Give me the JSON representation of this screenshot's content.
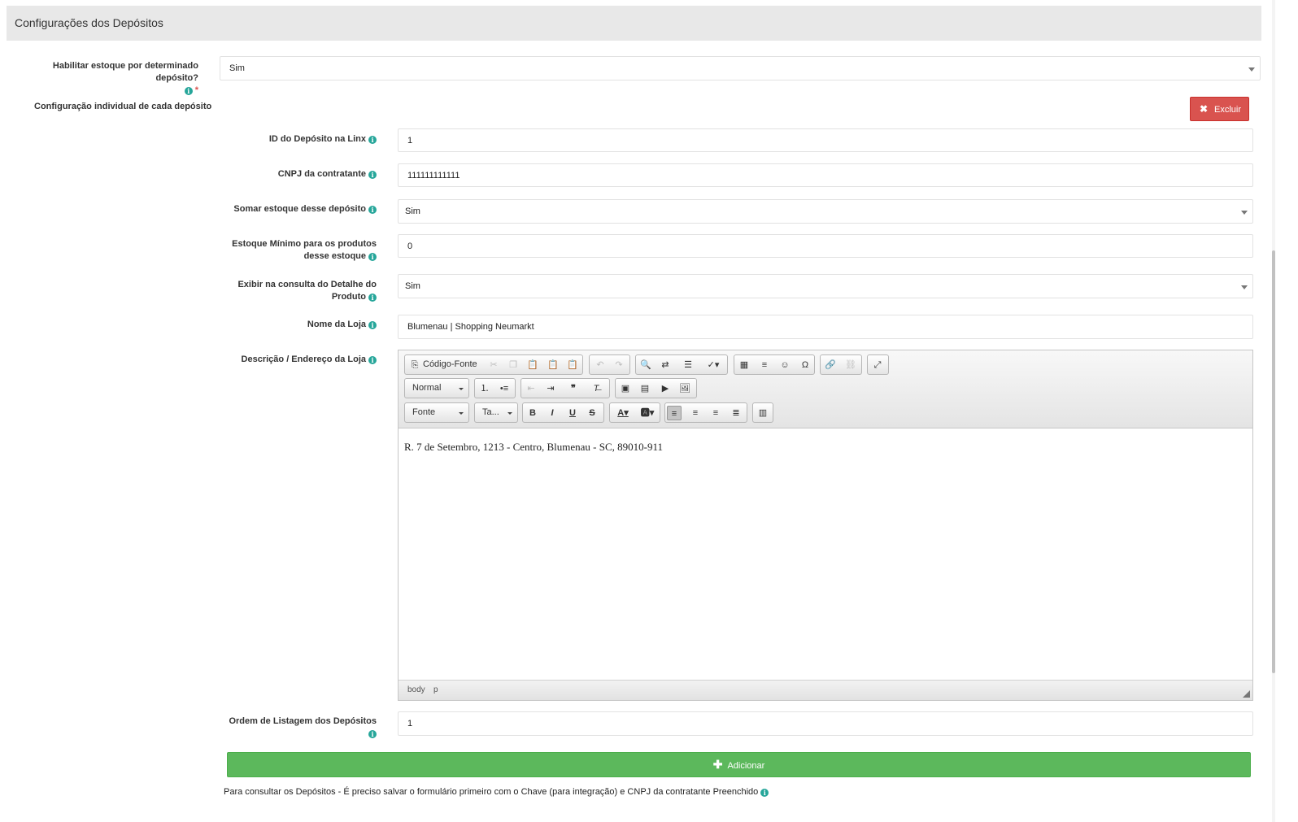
{
  "section": {
    "title": "Configurações dos Depósitos"
  },
  "enable_stock": {
    "label": "Habilitar estoque por determinado depósito?",
    "required_mark": "*",
    "value": "Sim"
  },
  "individual": {
    "label": "Configuração individual de cada depósito",
    "delete_label": "Excluir"
  },
  "deposit": {
    "id": {
      "label": "ID do Depósito na Linx",
      "value": "1"
    },
    "cnpj": {
      "label": "CNPJ da contratante",
      "value": "111111111111"
    },
    "sum_stock": {
      "label": "Somar estoque desse depósito",
      "value": "Sim"
    },
    "min_stock": {
      "label_line1": "Estoque Mínimo para os produtos",
      "label_line2": "desse estoque",
      "value": "0"
    },
    "show_detail": {
      "label_line1": "Exibir na consulta do Detalhe do",
      "label_line2": "Produto",
      "value": "Sim"
    },
    "store_name": {
      "label": "Nome da Loja",
      "value": "Blumenau | Shopping Neumarkt"
    },
    "description": {
      "label": "Descrição / Endereço da Loja"
    },
    "order": {
      "label": "Ordem de Listagem dos Depósitos",
      "value": "1"
    }
  },
  "editor": {
    "source_label": "Código-Fonte",
    "format_value": "Normal",
    "font_value": "Fonte",
    "size_value": "Ta...",
    "content": "R. 7 de Setembro, 1213 - Centro, Blumenau - SC, 89010-911",
    "path": [
      "body",
      "p"
    ]
  },
  "add_label": "Adicionar",
  "footer_note": "Para consultar os Depósitos - É preciso salvar o formulário primeiro com o Chave (para integração) e CNPJ da contratante Preenchido",
  "info_glyph": "i",
  "colors": {
    "info": "#26a69a",
    "danger": "#d9534f",
    "success": "#5cb85c",
    "header_bg": "#e8e8e8"
  }
}
